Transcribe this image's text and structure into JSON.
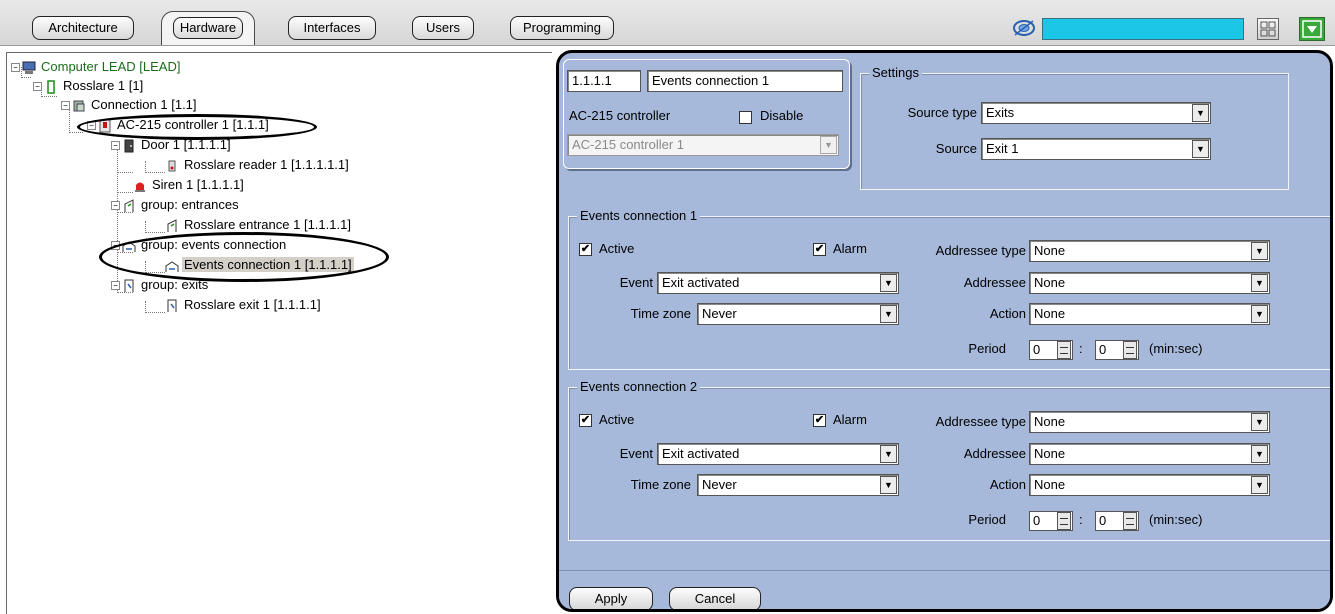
{
  "toolbar": {
    "tabs": [
      {
        "label": "Architecture",
        "active": false
      },
      {
        "label": "Hardware",
        "active": true
      },
      {
        "label": "Interfaces",
        "active": false
      },
      {
        "label": "Users",
        "active": false
      },
      {
        "label": "Programming",
        "active": false
      }
    ],
    "accent_color": "#1cc6e7",
    "menu_button_color": "#38a838",
    "icons": [
      "network-icon",
      "grid-layout-icon",
      "dropdown-menu-icon"
    ]
  },
  "tree": {
    "nodes": [
      {
        "label": "Computer LEAD [LEAD]",
        "icon": "computer-icon"
      },
      {
        "label": "Rosslare 1 [1]",
        "icon": "rosslare-icon"
      },
      {
        "label": "Connection 1 [1.1]",
        "icon": "connection-icon"
      },
      {
        "label": "AC-215 controller 1 [1.1.1]",
        "icon": "controller-icon"
      },
      {
        "label": "Door 1 [1.1.1.1]",
        "icon": "door-icon"
      },
      {
        "label": "Rosslare reader 1 [1.1.1.1.1]",
        "icon": "reader-icon"
      },
      {
        "label": "Siren 1 [1.1.1.1]",
        "icon": "siren-icon"
      },
      {
        "label": "group: entrances",
        "icon": "entrance-icon"
      },
      {
        "label": "Rosslare entrance 1 [1.1.1.1]",
        "icon": "entrance-icon"
      },
      {
        "label": "group: events connection",
        "icon": "events-connection-icon"
      },
      {
        "label": "Events connection 1 [1.1.1.1]",
        "icon": "events-connection-icon"
      },
      {
        "label": "group: exits",
        "icon": "exit-icon"
      },
      {
        "label": "Rosslare exit 1 [1.1.1.1]",
        "icon": "exit-icon"
      }
    ],
    "selected": "Events connection 1 [1.1.1.1]"
  },
  "header": {
    "id": "1.1.1.1",
    "name": "Events connection 1",
    "parent_label": "AC-215 controller",
    "disable_label": "Disable",
    "disable_checked": false,
    "parent_value": "AC-215 controller 1"
  },
  "settings": {
    "title": "Settings",
    "source_type_label": "Source type",
    "source_type_value": "Exits",
    "source_label": "Source",
    "source_value": "Exit 1"
  },
  "connections": [
    {
      "title": "Events connection 1",
      "active_label": "Active",
      "active": true,
      "alarm_label": "Alarm",
      "alarm": true,
      "event_label": "Event",
      "event_value": "Exit activated",
      "timezone_label": "Time zone",
      "timezone_value": "Never",
      "addressee_type_label": "Addressee type",
      "addressee_type_value": "None",
      "addressee_label": "Addressee",
      "addressee_value": "None",
      "action_label": "Action",
      "action_value": "None",
      "period_label": "Period",
      "period_min": "0",
      "period_colon": ":",
      "period_sec": "0",
      "period_unit": "(min:sec)"
    },
    {
      "title": "Events connection 2",
      "active_label": "Active",
      "active": true,
      "alarm_label": "Alarm",
      "alarm": true,
      "event_label": "Event",
      "event_value": "Exit activated",
      "timezone_label": "Time zone",
      "timezone_value": "Never",
      "addressee_type_label": "Addressee type",
      "addressee_type_value": "None",
      "addressee_label": "Addressee",
      "addressee_value": "None",
      "action_label": "Action",
      "action_value": "None",
      "period_label": "Period",
      "period_min": "0",
      "period_colon": ":",
      "period_sec": "0",
      "period_unit": "(min:sec)"
    }
  ],
  "footer": {
    "apply_label": "Apply",
    "cancel_label": "Cancel"
  },
  "check_mark": "✔",
  "panel_color": "#a6b9da"
}
